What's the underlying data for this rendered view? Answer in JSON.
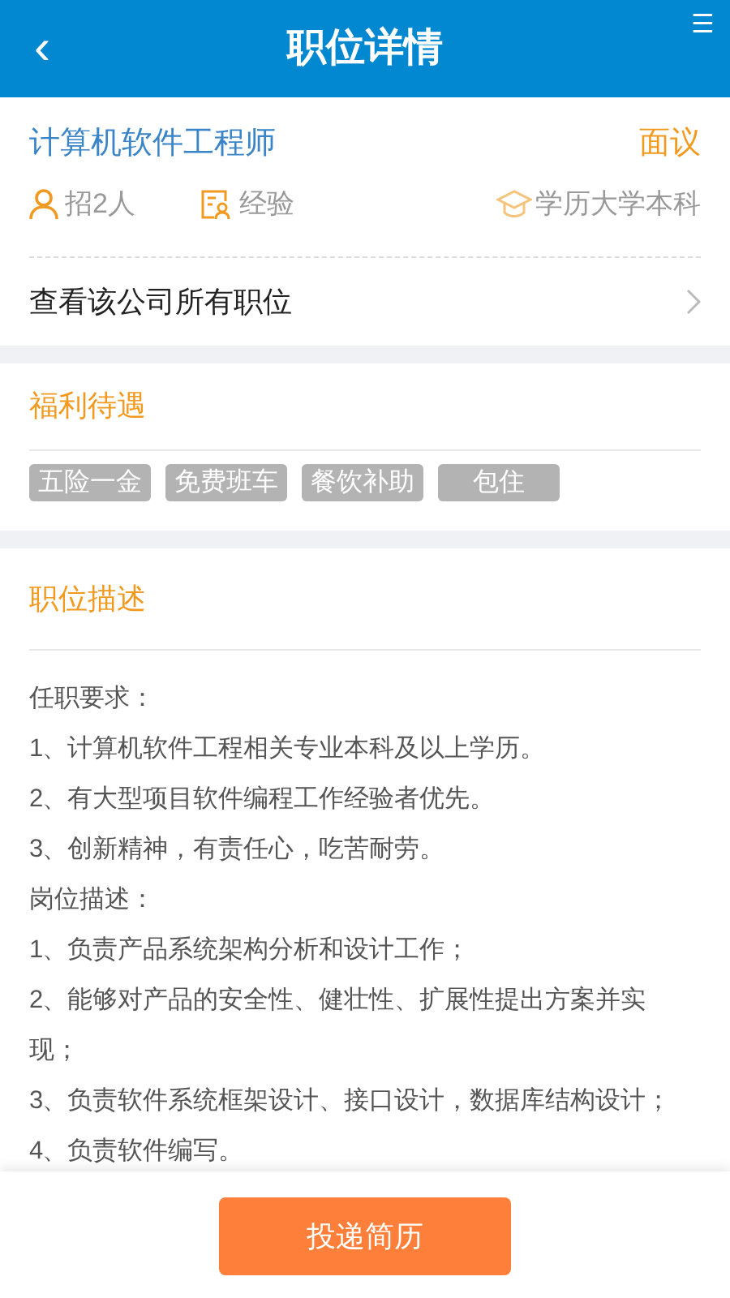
{
  "header": {
    "back": "‹",
    "title": "职位详情",
    "menu": "☰"
  },
  "job": {
    "title": "计算机软件工程师",
    "salary": "面议",
    "headcount": "招2人",
    "experience": "经验",
    "education": "学历大学本科"
  },
  "company_link": {
    "label": "查看该公司所有职位"
  },
  "benefits": {
    "title": "福利待遇",
    "tags": [
      "五险一金",
      "免费班车",
      "餐饮补助",
      "包住"
    ]
  },
  "description": {
    "title": "职位描述",
    "lines": [
      "任职要求：",
      "1、计算机软件工程相关专业本科及以上学历。",
      "2、有大型项目软件编程工作经验者优先。",
      "3、创新精神，有责任心，吃苦耐劳。",
      "岗位描述：",
      "1、负责产品系统架构分析和设计工作；",
      "2、能够对产品的安全性、健壮性、扩展性提出方案并实现；",
      "3、负责软件系统框架设计、接口设计，数据库结构设计；",
      "4、负责软件编写。"
    ]
  },
  "apply_button": "投递简历"
}
